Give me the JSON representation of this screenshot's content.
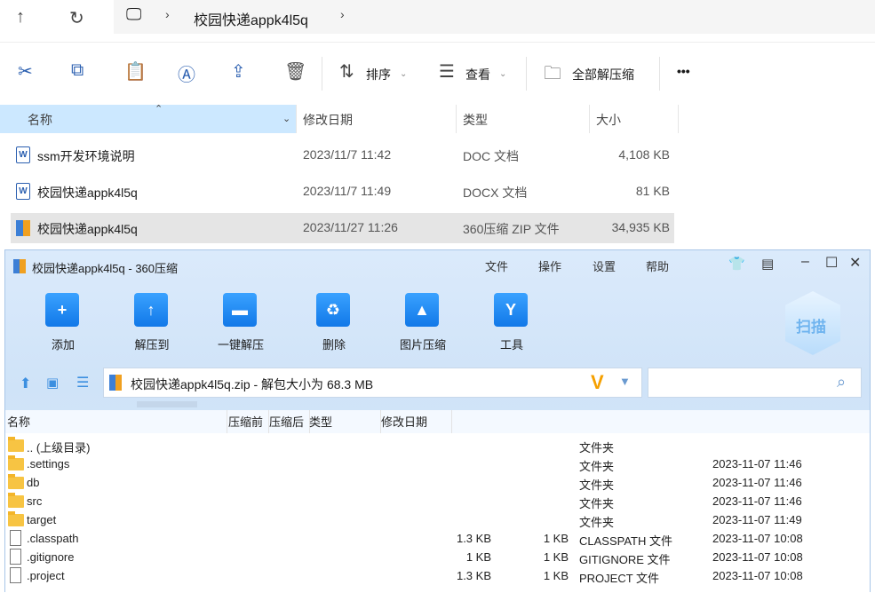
{
  "explorer": {
    "breadcrumb": [
      "校园快递appk4l5q"
    ],
    "toolbar": {
      "sort": "排序",
      "view": "查看",
      "extract_all": "全部解压缩",
      "more": "•••"
    },
    "columns": [
      "名称",
      "修改日期",
      "类型",
      "大小"
    ],
    "files": [
      {
        "name": "ssm开发环境说明",
        "date": "2023/11/7 11:42",
        "type": "DOC 文档",
        "size": "4,108 KB",
        "icon": "word-doc-icon"
      },
      {
        "name": "校园快递appk4l5q",
        "date": "2023/11/7 11:49",
        "type": "DOCX 文档",
        "size": "81 KB",
        "icon": "word-doc-icon"
      },
      {
        "name": "校园快递appk4l5q",
        "date": "2023/11/27 11:26",
        "type": "360压缩 ZIP 文件",
        "size": "34,935 KB",
        "icon": "zip-archive-icon",
        "selected": true
      }
    ]
  },
  "zip": {
    "title": "校园快递appk4l5q - 360压缩",
    "menu": [
      "文件",
      "操作",
      "设置",
      "帮助"
    ],
    "tools": [
      "添加",
      "解压到",
      "一键解压",
      "删除",
      "图片压缩",
      "工具"
    ],
    "scan": "扫描",
    "path": "校园快递appk4l5q.zip - 解包大小为 68.3 MB",
    "columns": [
      "名称",
      "压缩前",
      "压缩后",
      "类型",
      "修改日期"
    ],
    "rows": [
      {
        "name": ".. (上级目录)",
        "before": "",
        "after": "",
        "type": "文件夹",
        "date": "",
        "kind": "folder"
      },
      {
        "name": ".settings",
        "before": "",
        "after": "",
        "type": "文件夹",
        "date": "2023-11-07 11:46",
        "kind": "folder"
      },
      {
        "name": "db",
        "before": "",
        "after": "",
        "type": "文件夹",
        "date": "2023-11-07 11:46",
        "kind": "folder"
      },
      {
        "name": "src",
        "before": "",
        "after": "",
        "type": "文件夹",
        "date": "2023-11-07 11:46",
        "kind": "folder"
      },
      {
        "name": "target",
        "before": "",
        "after": "",
        "type": "文件夹",
        "date": "2023-11-07 11:49",
        "kind": "folder"
      },
      {
        "name": ".classpath",
        "before": "1.3 KB",
        "after": "1 KB",
        "type": "CLASSPATH 文件",
        "date": "2023-11-07 10:08",
        "kind": "file"
      },
      {
        "name": ".gitignore",
        "before": "1 KB",
        "after": "1 KB",
        "type": "GITIGNORE 文件",
        "date": "2023-11-07 10:08",
        "kind": "file"
      },
      {
        "name": ".project",
        "before": "1.3 KB",
        "after": "1 KB",
        "type": "PROJECT 文件",
        "date": "2023-11-07 10:08",
        "kind": "file"
      }
    ]
  }
}
